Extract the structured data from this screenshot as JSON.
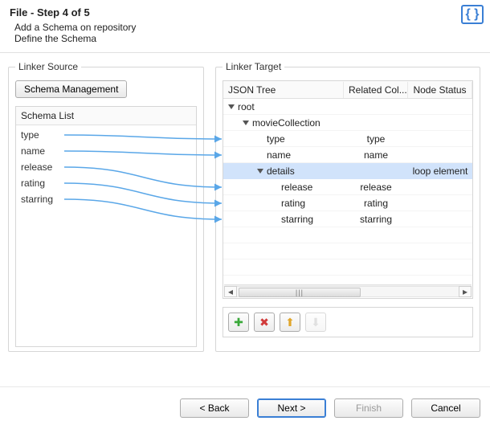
{
  "header": {
    "title": "File - Step 4 of 5",
    "subtitle1": "Add a Schema on repository",
    "subtitle2": "Define the Schema",
    "icon_name": "json-braces-icon"
  },
  "source": {
    "legend": "Linker Source",
    "manage_button": "Schema Management",
    "list_header": "Schema List",
    "items": [
      "type",
      "name",
      "release",
      "rating",
      "starring"
    ]
  },
  "target": {
    "legend": "Linker Target",
    "columns": {
      "tree": "JSON Tree",
      "related": "Related Col...",
      "status": "Node Status"
    },
    "rows": [
      {
        "indent": 0,
        "expander": true,
        "label": "root",
        "related": "",
        "status": "",
        "selected": false
      },
      {
        "indent": 1,
        "expander": true,
        "label": "movieCollection",
        "related": "",
        "status": "",
        "selected": false
      },
      {
        "indent": 2,
        "expander": false,
        "label": "type",
        "related": "type",
        "status": "",
        "selected": false
      },
      {
        "indent": 2,
        "expander": false,
        "label": "name",
        "related": "name",
        "status": "",
        "selected": false
      },
      {
        "indent": 2,
        "expander": true,
        "label": "details",
        "related": "",
        "status": "loop element",
        "selected": true
      },
      {
        "indent": 3,
        "expander": false,
        "label": "release",
        "related": "release",
        "status": "",
        "selected": false
      },
      {
        "indent": 3,
        "expander": false,
        "label": "rating",
        "related": "rating",
        "status": "",
        "selected": false
      },
      {
        "indent": 3,
        "expander": false,
        "label": "starring",
        "related": "starring",
        "status": "",
        "selected": false
      }
    ],
    "toolbar": {
      "add": {
        "glyph": "✚",
        "color": "#3aa93a",
        "name": "add-icon"
      },
      "remove": {
        "glyph": "✖",
        "color": "#d13a3a",
        "name": "remove-icon"
      },
      "up": {
        "glyph": "⬆",
        "color": "#e0a52a",
        "name": "arrow-up-icon"
      },
      "down": {
        "glyph": "⬇",
        "color": "#bbbbbb",
        "name": "arrow-down-icon",
        "disabled": true
      }
    }
  },
  "footer": {
    "back": "< Back",
    "next": "Next >",
    "finish": "Finish",
    "cancel": "Cancel"
  },
  "links": [
    {
      "from": 0,
      "to": 2
    },
    {
      "from": 1,
      "to": 3
    },
    {
      "from": 2,
      "to": 5
    },
    {
      "from": 3,
      "to": 6
    },
    {
      "from": 4,
      "to": 7
    }
  ],
  "link_style": {
    "arrow_color": "#5aa7e8"
  }
}
